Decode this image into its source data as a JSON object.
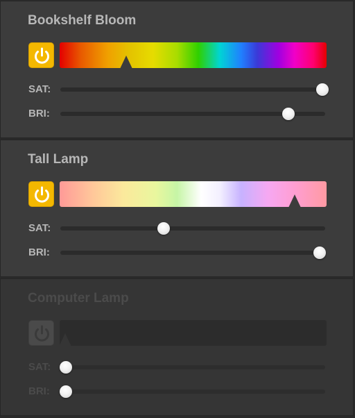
{
  "lamps": [
    {
      "name": "Bookshelf Bloom",
      "on": true,
      "hue_style": "rainbow",
      "hue_marker": 0.25,
      "sat_label": "SAT:",
      "bri_label": "BRI:",
      "sat": 0.99,
      "bri": 0.86
    },
    {
      "name": "Tall Lamp",
      "on": true,
      "hue_style": "pastel",
      "hue_marker": 0.88,
      "sat_label": "SAT:",
      "bri_label": "BRI:",
      "sat": 0.39,
      "bri": 0.98
    },
    {
      "name": "Computer Lamp",
      "on": false,
      "hue_style": "off",
      "hue_marker": 0.02,
      "sat_label": "SAT:",
      "bri_label": "BRI:",
      "sat": 0.02,
      "bri": 0.02
    }
  ],
  "colors": {
    "power_on": "#f4b800",
    "power_off": "#4a4a4a",
    "panel_bg": "#3c3c3c",
    "text": "#b7b7b7",
    "text_disabled": "#4b4b4b"
  },
  "icons": {
    "power": "power-icon"
  }
}
